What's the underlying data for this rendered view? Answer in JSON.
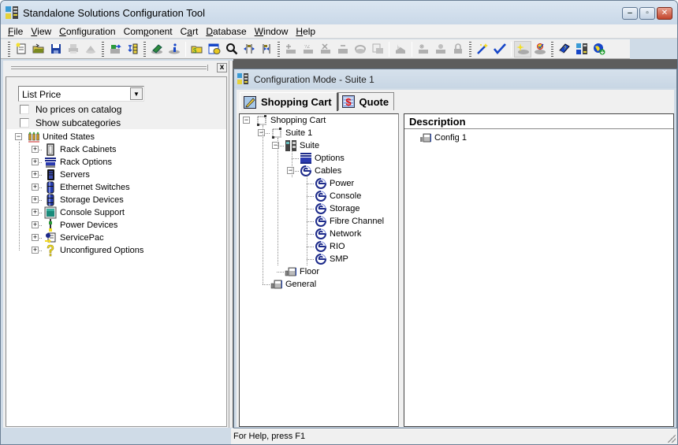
{
  "window": {
    "title": "Standalone Solutions Configuration Tool",
    "controls": {
      "minimize": "_",
      "maximize": "□",
      "close": "✕"
    }
  },
  "menu": [
    {
      "label": "File",
      "mnemonic": "F"
    },
    {
      "label": "View",
      "mnemonic": "V"
    },
    {
      "label": "Configuration",
      "mnemonic": "C"
    },
    {
      "label": "Component",
      "mnemonic": "p"
    },
    {
      "label": "Cart",
      "mnemonic": "a"
    },
    {
      "label": "Database",
      "mnemonic": "D"
    },
    {
      "label": "Window",
      "mnemonic": "W"
    },
    {
      "label": "Help",
      "mnemonic": "H"
    }
  ],
  "toolbar": {
    "groups": [
      [
        "new-icon",
        "open-icon",
        "save-icon",
        "print-icon",
        "print-preview-icon"
      ],
      [
        "import-icon",
        "rack-layout-icon"
      ],
      [
        "catalog-icon",
        "info-icon"
      ],
      [
        "open-folder-icon",
        "database-icon",
        "search-icon",
        "expand-icon",
        "collapse-icon"
      ],
      [
        "add-component-icon",
        "rename-component-icon",
        "delete-component-icon",
        "remove-component-icon",
        "cable-icon",
        "copy-component-icon"
      ],
      [
        "sparkle-component-icon"
      ],
      [
        "new-component-icon",
        "move-component-icon",
        "lock-component-icon"
      ],
      [
        "wizard-icon",
        "validate-icon"
      ],
      [
        "highlight-icon",
        "verify-icon"
      ],
      [
        "help-book-icon",
        "rack-config-icon",
        "web-update-icon"
      ]
    ]
  },
  "left_pane": {
    "close_label": "x",
    "price_select": {
      "value": "List Price"
    },
    "checkboxes": [
      {
        "label": "No prices on catalog",
        "checked": false
      },
      {
        "label": "Show subcategories",
        "checked": false
      }
    ],
    "tree": {
      "root": {
        "label": "United States",
        "icon": "flag-icon",
        "expanded": true
      },
      "children": [
        {
          "label": "Rack Cabinets",
          "icon": "rack-cabinet-icon"
        },
        {
          "label": "Rack Options",
          "icon": "rack-options-icon"
        },
        {
          "label": "Servers",
          "icon": "server-icon"
        },
        {
          "label": "Ethernet Switches",
          "icon": "switch-icon"
        },
        {
          "label": "Storage Devices",
          "icon": "storage-icon"
        },
        {
          "label": "Console Support",
          "icon": "monitor-icon"
        },
        {
          "label": "Power Devices",
          "icon": "power-icon"
        },
        {
          "label": "ServicePac",
          "icon": "servicepac-icon"
        },
        {
          "label": "Unconfigured Options",
          "icon": "question-icon"
        }
      ]
    }
  },
  "child_window": {
    "title": "Configuration Mode - Suite 1",
    "tabs": [
      {
        "label": "Shopping Cart",
        "active": true
      },
      {
        "label": "Quote",
        "active": false
      }
    ],
    "cart_tree": [
      {
        "label": "Shopping Cart",
        "level": 0,
        "expander": "-",
        "icon": "cart-icon"
      },
      {
        "label": "Suite 1",
        "level": 1,
        "expander": "-",
        "icon": "cart-icon"
      },
      {
        "label": "Suite",
        "level": 2,
        "expander": "-",
        "icon": "suite-icon"
      },
      {
        "label": "Options",
        "level": 3,
        "expander": "",
        "icon": "options-icon"
      },
      {
        "label": "Cables",
        "level": 3,
        "expander": "-",
        "icon": "cable-icon"
      },
      {
        "label": "Power",
        "level": 4,
        "expander": "",
        "icon": "cable-icon"
      },
      {
        "label": "Console",
        "level": 4,
        "expander": "",
        "icon": "cable-icon"
      },
      {
        "label": "Storage",
        "level": 4,
        "expander": "",
        "icon": "cable-icon"
      },
      {
        "label": "Fibre Channel",
        "level": 4,
        "expander": "",
        "icon": "cable-icon"
      },
      {
        "label": "Network",
        "level": 4,
        "expander": "",
        "icon": "cable-icon"
      },
      {
        "label": "RIO",
        "level": 4,
        "expander": "",
        "icon": "cable-icon"
      },
      {
        "label": "SMP",
        "level": 4,
        "expander": "",
        "icon": "cable-icon"
      },
      {
        "label": "Floor",
        "level": 2,
        "expander": "",
        "icon": "floor-icon"
      },
      {
        "label": "General",
        "level": 1,
        "expander": "",
        "icon": "floor-icon"
      }
    ],
    "description": {
      "header": "Description",
      "rows": [
        {
          "label": "Config 1",
          "icon": "config-icon"
        }
      ]
    }
  },
  "status_bar": {
    "text": "For Help, press F1"
  }
}
